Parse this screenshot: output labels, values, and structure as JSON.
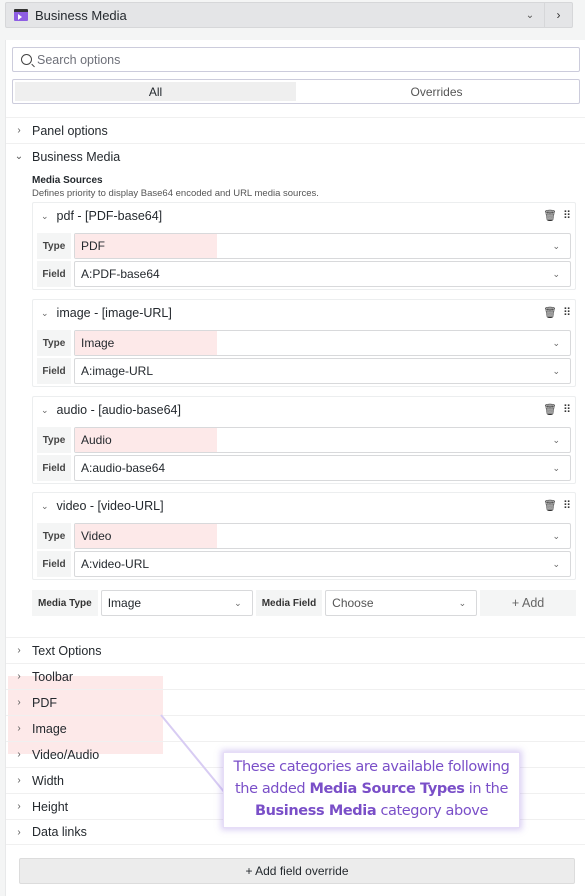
{
  "header": {
    "title": "Business Media",
    "logo_icon": "business-media-logo-icon"
  },
  "search": {
    "placeholder": "Search options"
  },
  "tabs": [
    {
      "label": "All",
      "active": true
    },
    {
      "label": "Overrides",
      "active": false
    }
  ],
  "categories_top": [
    {
      "label": "Panel options",
      "expanded": false
    },
    {
      "label": "Business Media",
      "expanded": true
    }
  ],
  "media_sources": {
    "title": "Media Sources",
    "description": "Defines priority to display Base64 encoded and URL media sources.",
    "type_label": "Type",
    "field_label": "Field",
    "items": [
      {
        "title": "pdf - [PDF-base64]",
        "type": "PDF",
        "field": "A:PDF-base64"
      },
      {
        "title": "image - [image-URL]",
        "type": "Image",
        "field": "A:image-URL"
      },
      {
        "title": "audio - [audio-base64]",
        "type": "Audio",
        "field": "A:audio-base64"
      },
      {
        "title": "video - [video-URL]",
        "type": "Video",
        "field": "A:video-URL"
      }
    ],
    "add_row": {
      "media_type_label": "Media Type",
      "media_type_value": "Image",
      "media_field_label": "Media Field",
      "media_field_value": "Choose",
      "add_label": "+ Add"
    }
  },
  "categories_bottom": [
    {
      "label": "Text Options",
      "highlight": false
    },
    {
      "label": "Toolbar",
      "highlight": false
    },
    {
      "label": "PDF",
      "highlight": true
    },
    {
      "label": "Image",
      "highlight": true
    },
    {
      "label": "Video/Audio",
      "highlight": true
    },
    {
      "label": "Width",
      "highlight": false
    },
    {
      "label": "Height",
      "highlight": false
    },
    {
      "label": "Data links",
      "highlight": false
    }
  ],
  "add_override_label": "+  Add field override",
  "callout": {
    "line1": "These categories are available following",
    "line2_pre": "the added ",
    "line2_bold": "Media Source Types",
    "line2_post": " in the",
    "line3_bold": "Business Media",
    "line3_post": " category above"
  },
  "colors": {
    "highlight": "#fde9e9",
    "callout_text": "#7a4fc8"
  }
}
